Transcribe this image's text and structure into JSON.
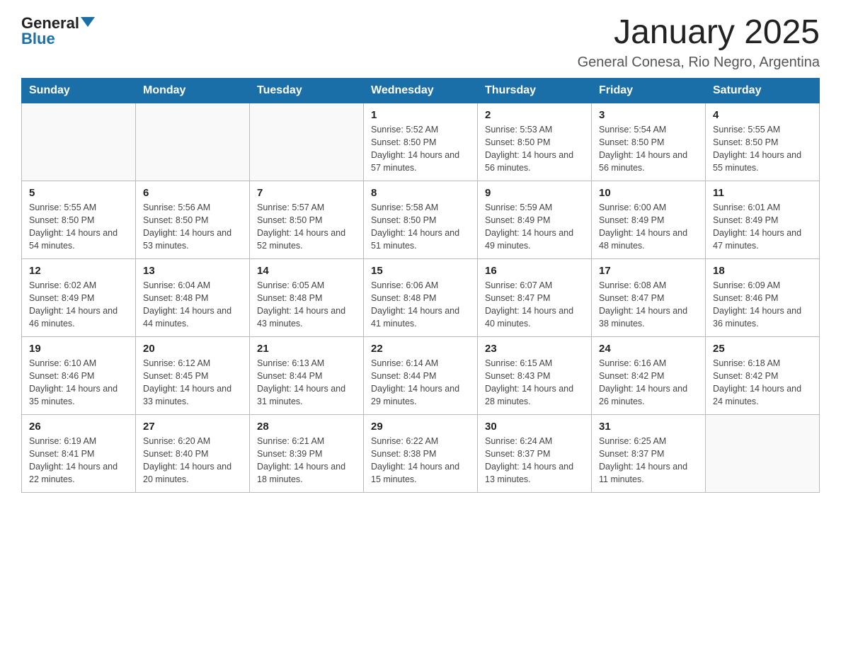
{
  "logo": {
    "text_general": "General",
    "text_blue": "Blue"
  },
  "title": "January 2025",
  "subtitle": "General Conesa, Rio Negro, Argentina",
  "days_header": [
    "Sunday",
    "Monday",
    "Tuesday",
    "Wednesday",
    "Thursday",
    "Friday",
    "Saturday"
  ],
  "weeks": [
    [
      {
        "day": "",
        "info": ""
      },
      {
        "day": "",
        "info": ""
      },
      {
        "day": "",
        "info": ""
      },
      {
        "day": "1",
        "info": "Sunrise: 5:52 AM\nSunset: 8:50 PM\nDaylight: 14 hours and 57 minutes."
      },
      {
        "day": "2",
        "info": "Sunrise: 5:53 AM\nSunset: 8:50 PM\nDaylight: 14 hours and 56 minutes."
      },
      {
        "day": "3",
        "info": "Sunrise: 5:54 AM\nSunset: 8:50 PM\nDaylight: 14 hours and 56 minutes."
      },
      {
        "day": "4",
        "info": "Sunrise: 5:55 AM\nSunset: 8:50 PM\nDaylight: 14 hours and 55 minutes."
      }
    ],
    [
      {
        "day": "5",
        "info": "Sunrise: 5:55 AM\nSunset: 8:50 PM\nDaylight: 14 hours and 54 minutes."
      },
      {
        "day": "6",
        "info": "Sunrise: 5:56 AM\nSunset: 8:50 PM\nDaylight: 14 hours and 53 minutes."
      },
      {
        "day": "7",
        "info": "Sunrise: 5:57 AM\nSunset: 8:50 PM\nDaylight: 14 hours and 52 minutes."
      },
      {
        "day": "8",
        "info": "Sunrise: 5:58 AM\nSunset: 8:50 PM\nDaylight: 14 hours and 51 minutes."
      },
      {
        "day": "9",
        "info": "Sunrise: 5:59 AM\nSunset: 8:49 PM\nDaylight: 14 hours and 49 minutes."
      },
      {
        "day": "10",
        "info": "Sunrise: 6:00 AM\nSunset: 8:49 PM\nDaylight: 14 hours and 48 minutes."
      },
      {
        "day": "11",
        "info": "Sunrise: 6:01 AM\nSunset: 8:49 PM\nDaylight: 14 hours and 47 minutes."
      }
    ],
    [
      {
        "day": "12",
        "info": "Sunrise: 6:02 AM\nSunset: 8:49 PM\nDaylight: 14 hours and 46 minutes."
      },
      {
        "day": "13",
        "info": "Sunrise: 6:04 AM\nSunset: 8:48 PM\nDaylight: 14 hours and 44 minutes."
      },
      {
        "day": "14",
        "info": "Sunrise: 6:05 AM\nSunset: 8:48 PM\nDaylight: 14 hours and 43 minutes."
      },
      {
        "day": "15",
        "info": "Sunrise: 6:06 AM\nSunset: 8:48 PM\nDaylight: 14 hours and 41 minutes."
      },
      {
        "day": "16",
        "info": "Sunrise: 6:07 AM\nSunset: 8:47 PM\nDaylight: 14 hours and 40 minutes."
      },
      {
        "day": "17",
        "info": "Sunrise: 6:08 AM\nSunset: 8:47 PM\nDaylight: 14 hours and 38 minutes."
      },
      {
        "day": "18",
        "info": "Sunrise: 6:09 AM\nSunset: 8:46 PM\nDaylight: 14 hours and 36 minutes."
      }
    ],
    [
      {
        "day": "19",
        "info": "Sunrise: 6:10 AM\nSunset: 8:46 PM\nDaylight: 14 hours and 35 minutes."
      },
      {
        "day": "20",
        "info": "Sunrise: 6:12 AM\nSunset: 8:45 PM\nDaylight: 14 hours and 33 minutes."
      },
      {
        "day": "21",
        "info": "Sunrise: 6:13 AM\nSunset: 8:44 PM\nDaylight: 14 hours and 31 minutes."
      },
      {
        "day": "22",
        "info": "Sunrise: 6:14 AM\nSunset: 8:44 PM\nDaylight: 14 hours and 29 minutes."
      },
      {
        "day": "23",
        "info": "Sunrise: 6:15 AM\nSunset: 8:43 PM\nDaylight: 14 hours and 28 minutes."
      },
      {
        "day": "24",
        "info": "Sunrise: 6:16 AM\nSunset: 8:42 PM\nDaylight: 14 hours and 26 minutes."
      },
      {
        "day": "25",
        "info": "Sunrise: 6:18 AM\nSunset: 8:42 PM\nDaylight: 14 hours and 24 minutes."
      }
    ],
    [
      {
        "day": "26",
        "info": "Sunrise: 6:19 AM\nSunset: 8:41 PM\nDaylight: 14 hours and 22 minutes."
      },
      {
        "day": "27",
        "info": "Sunrise: 6:20 AM\nSunset: 8:40 PM\nDaylight: 14 hours and 20 minutes."
      },
      {
        "day": "28",
        "info": "Sunrise: 6:21 AM\nSunset: 8:39 PM\nDaylight: 14 hours and 18 minutes."
      },
      {
        "day": "29",
        "info": "Sunrise: 6:22 AM\nSunset: 8:38 PM\nDaylight: 14 hours and 15 minutes."
      },
      {
        "day": "30",
        "info": "Sunrise: 6:24 AM\nSunset: 8:37 PM\nDaylight: 14 hours and 13 minutes."
      },
      {
        "day": "31",
        "info": "Sunrise: 6:25 AM\nSunset: 8:37 PM\nDaylight: 14 hours and 11 minutes."
      },
      {
        "day": "",
        "info": ""
      }
    ]
  ]
}
